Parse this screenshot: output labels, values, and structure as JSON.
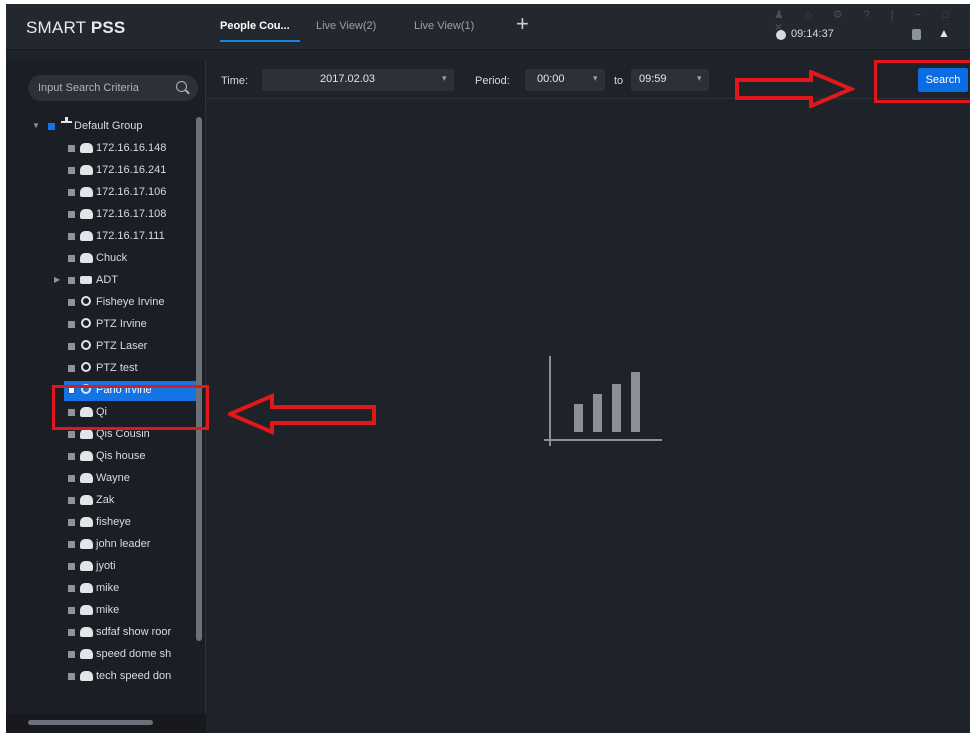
{
  "app": {
    "logo_light": "SMART ",
    "logo_bold": "PSS",
    "clock": "09:14:37"
  },
  "tabs": [
    {
      "label": "People Cou...",
      "active": true
    },
    {
      "label": "Live View(2)",
      "active": false
    },
    {
      "label": "Live View(1)",
      "active": false
    }
  ],
  "add_tab": "+",
  "window_controls": "♟ ⌂ ⚙ ? | − □ ✕",
  "search": {
    "placeholder": "Input Search Criteria"
  },
  "tree": {
    "root": "Default Group",
    "items": [
      {
        "label": "172.16.16.148",
        "icon": "camera-icon"
      },
      {
        "label": "172.16.16.241",
        "icon": "camera-icon"
      },
      {
        "label": "172.16.17.106",
        "icon": "camera-icon"
      },
      {
        "label": "172.16.17.108",
        "icon": "camera-icon"
      },
      {
        "label": "172.16.17.111",
        "icon": "camera-icon"
      },
      {
        "label": "Chuck",
        "icon": "camera-icon"
      },
      {
        "label": "ADT",
        "icon": "nvr-icon"
      },
      {
        "label": "Fisheye Irvine",
        "icon": "fisheye-icon"
      },
      {
        "label": "PTZ Irvine",
        "icon": "fisheye-icon"
      },
      {
        "label": "PTZ Laser",
        "icon": "fisheye-icon"
      },
      {
        "label": "PTZ test",
        "icon": "fisheye-icon"
      },
      {
        "label": "Pano Irvine",
        "icon": "fisheye-icon",
        "selected": true
      },
      {
        "label": "Qi",
        "icon": "camera-icon"
      },
      {
        "label": "Qis Cousin",
        "icon": "camera-icon"
      },
      {
        "label": "Qis house",
        "icon": "camera-icon"
      },
      {
        "label": "Wayne",
        "icon": "camera-icon"
      },
      {
        "label": "Zak",
        "icon": "camera-icon"
      },
      {
        "label": "fisheye",
        "icon": "camera-icon"
      },
      {
        "label": "john leader",
        "icon": "camera-icon"
      },
      {
        "label": "jyoti",
        "icon": "camera-icon"
      },
      {
        "label": "mike",
        "icon": "camera-icon"
      },
      {
        "label": "mike",
        "icon": "camera-icon"
      },
      {
        "label": "sdfaf show roor",
        "icon": "camera-icon"
      },
      {
        "label": "speed dome sh",
        "icon": "camera-icon"
      },
      {
        "label": "tech speed don",
        "icon": "camera-icon"
      }
    ]
  },
  "toolbar": {
    "time_label": "Time:",
    "date": "2017.02.03",
    "period_label": "Period:",
    "start": "00:00",
    "to_label": "to",
    "end": "09:59",
    "search_label": "Search"
  },
  "colors": {
    "accent": "#1374e3",
    "annotation": "#e0181b",
    "background": "#1e2229"
  }
}
